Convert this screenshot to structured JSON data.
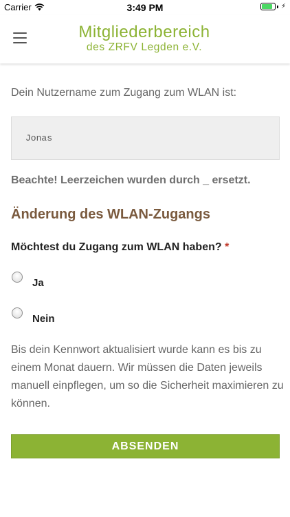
{
  "status_bar": {
    "carrier": "Carrier",
    "time": "3:49 PM",
    "battery_level": 0.85,
    "wifi_icon": "wifi-icon",
    "charge_icon": "charging-bolt-icon"
  },
  "header": {
    "menu_icon": "hamburger-menu-icon",
    "title": "Mitgliederbereich",
    "subtitle": "des ZRFV Legden e.V."
  },
  "form": {
    "intro": "Dein Nutzername zum Zugang zum WLAN ist:",
    "username_value": "Jonas",
    "notice": "Beachte! Leerzeichen wurden durch _ ersetzt.",
    "section_title": "Änderung des WLAN-Zugangs",
    "question": "Möchtest du Zugang zum WLAN haben?",
    "required_marker": "*",
    "options": [
      {
        "label": "Ja",
        "selected": false
      },
      {
        "label": "Nein",
        "selected": false
      }
    ],
    "info": "Bis dein Kennwort aktualisiert wurde kann es bis zu einem Monat dauern. Wir müssen die Daten jeweils manuell einpflegen, um so die Sicherheit maximieren zu können.",
    "submit_label": "ABSENDEN"
  },
  "colors": {
    "brand_green": "#8cb334",
    "section_brown": "#7a5a3e",
    "required_red": "#c0392b"
  }
}
